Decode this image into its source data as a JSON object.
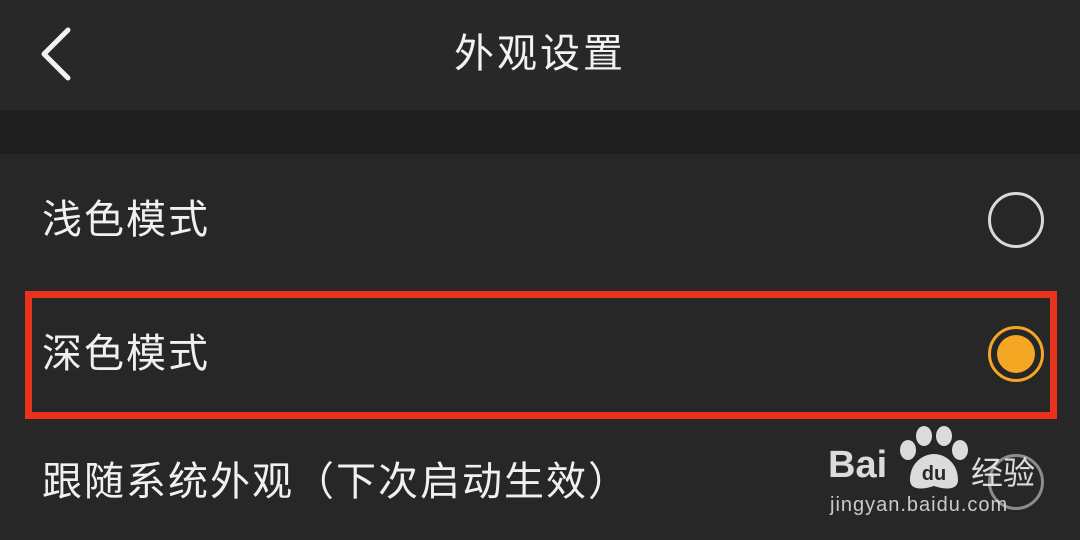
{
  "header": {
    "title": "外观设置",
    "back_icon": "chevron-left-icon"
  },
  "options": [
    {
      "label": "浅色模式",
      "selected": false
    },
    {
      "label": "深色模式",
      "selected": true
    },
    {
      "label": "跟随系统外观（下次启动生效）",
      "selected": false
    }
  ],
  "colors": {
    "background": "#272727",
    "section_gap": "#1e1e1e",
    "accent": "#f5a623",
    "highlight": "#e8321b",
    "text": "#f0f0f0"
  },
  "watermark": {
    "brand": "Bai",
    "brand_suffix": "经验",
    "url": "jingyan.baidu.com"
  }
}
